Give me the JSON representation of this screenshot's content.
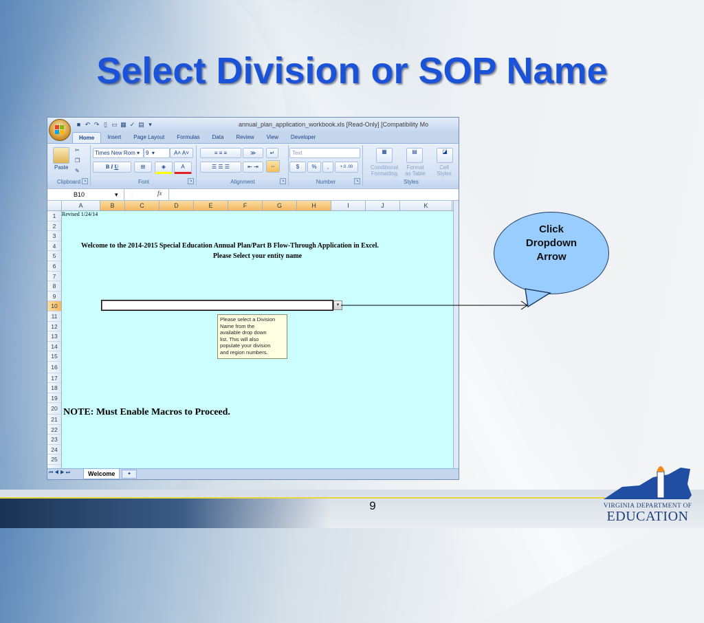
{
  "slide": {
    "title": "Select Division or SOP Name",
    "page_number": "9",
    "logo_line1": "Virginia Department of",
    "logo_line2": "Education"
  },
  "excel": {
    "window_title": "annual_plan_application_workbook.xls  [Read-Only]  [Compatibility Mo",
    "tabs": [
      "Home",
      "Insert",
      "Page Layout",
      "Formulas",
      "Data",
      "Review",
      "View",
      "Developer"
    ],
    "ribbon": {
      "clipboard_label": "Clipboard",
      "paste_label": "Paste",
      "font_label": "Font",
      "font_name": "Times New Rom",
      "font_size": "9",
      "alignment_label": "Alignment",
      "number_label": "Number",
      "number_format": "Text",
      "currency": "$",
      "percent": "%",
      "styles_label": "Styles",
      "conditional_formatting": "Conditional\nFormatting",
      "format_as_table": "Format\nas Table",
      "cell_styles": "Cell\nStyles"
    },
    "name_box": "B10",
    "fx": "fx",
    "columns": [
      "A",
      "B",
      "C",
      "D",
      "E",
      "F",
      "G",
      "H",
      "I",
      "J",
      "K"
    ],
    "selected_columns": [
      "B",
      "C",
      "D",
      "E",
      "F",
      "G",
      "H"
    ],
    "rows": [
      "1",
      "2",
      "3",
      "4",
      "5",
      "6",
      "7",
      "8",
      "9",
      "10",
      "11",
      "12",
      "13",
      "14",
      "15",
      "16",
      "17",
      "18",
      "19",
      "20",
      "21",
      "22",
      "23",
      "24",
      "25"
    ],
    "selected_row": "10",
    "cells": {
      "revised": "Revised 1/24/14",
      "welcome": "Welcome to the 2014-2015 Special Education Annual Plan/Part B Flow-Through Application in Excel.",
      "select_entity": "Please Select your entity name",
      "note": "NOTE: Must Enable Macros to Proceed."
    },
    "comment": "Please select a Division\nName from the\navailable drop down\nlist.  This will also\npopulate your division\nand region numbers.",
    "sheet_tab": "Welcome",
    "colors": {
      "sheet_background": "#ccffff",
      "ribbon": "#d3e1f3"
    }
  },
  "callout": {
    "text": "Click\nDropdown\nArrow"
  },
  "colors": {
    "title": "#1a52d8",
    "callout_fill": "#99ccff",
    "accent_line": "#e8d73a"
  }
}
